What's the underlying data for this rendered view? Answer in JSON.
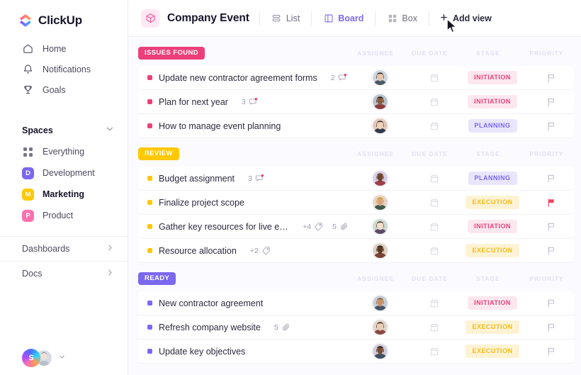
{
  "brand": {
    "name": "ClickUp",
    "logo_icon": "clickup-logo-icon"
  },
  "sidebar": {
    "nav": [
      {
        "label": "Home",
        "icon": "home-icon"
      },
      {
        "label": "Notifications",
        "icon": "bell-icon"
      },
      {
        "label": "Goals",
        "icon": "trophy-icon"
      }
    ],
    "spaces_header": {
      "label": "Spaces",
      "icon": "chevron-down-icon"
    },
    "spaces": [
      {
        "label": "Everything",
        "initial": "",
        "color": "#76758a",
        "type": "dots",
        "active": false
      },
      {
        "label": "Development",
        "initial": "D",
        "color": "#7b68ee",
        "type": "square",
        "active": false
      },
      {
        "label": "Marketing",
        "initial": "M",
        "color": "#ffc800",
        "type": "square",
        "active": true
      },
      {
        "label": "Product",
        "initial": "P",
        "color": "#fd71af",
        "type": "square",
        "active": false
      }
    ],
    "sections": [
      {
        "label": "Dashboards",
        "icon": "chevron-right-icon"
      },
      {
        "label": "Docs",
        "icon": "chevron-right-icon"
      }
    ],
    "user": {
      "initial": "S",
      "chevron_icon": "chevron-down-icon",
      "avatar_icon": "user-avatar"
    }
  },
  "header": {
    "project_icon": "box-3d-icon",
    "title": "Company Event",
    "views": [
      {
        "label": "List",
        "icon": "list-icon",
        "active": false
      },
      {
        "label": "Board",
        "icon": "board-icon",
        "active": true
      },
      {
        "label": "Box",
        "icon": "box-grid-icon",
        "active": false
      }
    ],
    "add_view": {
      "label": "Add view",
      "icon": "plus-icon"
    }
  },
  "board": {
    "column_headers": [
      "ASSIGNEE",
      "DUE DATE",
      "STAGE",
      "PRIORITY"
    ],
    "stage_colors": {
      "INITIATION": {
        "fg": "#ec3f79",
        "bg": "#fde7ef"
      },
      "PLANNING": {
        "fg": "#7b68ee",
        "bg": "#e8e5fd"
      },
      "EXECUTION": {
        "fg": "#f5bb16",
        "bg": "#fdf3d4"
      }
    },
    "groups": [
      {
        "label": "ISSUES FOUND",
        "badge_color": "#ec3f79",
        "bullet_color": "#ec3f79",
        "tasks": [
          {
            "title": "Update new contractor agreement forms",
            "comments": "2",
            "comments_icon": "comment-icon",
            "comment_unread": true,
            "tags": "",
            "attachments": "",
            "due_icon": "calendar-icon",
            "stage": "INITIATION",
            "priority_icon": "flag-icon",
            "priority_flagged": false,
            "avatar": "avatar-1"
          },
          {
            "title": "Plan for next year",
            "comments": "3",
            "comments_icon": "comment-icon",
            "comment_unread": true,
            "tags": "",
            "attachments": "",
            "due_icon": "calendar-icon",
            "stage": "INITIATION",
            "priority_icon": "flag-icon",
            "priority_flagged": false,
            "avatar": "avatar-2"
          },
          {
            "title": "How to manage event planning",
            "comments": "",
            "comments_icon": "",
            "comment_unread": false,
            "tags": "",
            "attachments": "",
            "due_icon": "calendar-icon",
            "stage": "PLANNING",
            "priority_icon": "flag-icon",
            "priority_flagged": false,
            "avatar": "avatar-3"
          }
        ]
      },
      {
        "label": "REVIEW",
        "badge_color": "#ffc800",
        "bullet_color": "#ffc800",
        "tasks": [
          {
            "title": "Budget assignment",
            "comments": "3",
            "comments_icon": "comment-icon",
            "comment_unread": true,
            "tags": "",
            "attachments": "",
            "due_icon": "calendar-icon",
            "stage": "PLANNING",
            "priority_icon": "flag-icon",
            "priority_flagged": false,
            "avatar": "avatar-4"
          },
          {
            "title": "Finalize project scope",
            "comments": "",
            "comments_icon": "",
            "comment_unread": false,
            "tags": "",
            "attachments": "",
            "due_icon": "calendar-icon",
            "stage": "EXECUTION",
            "priority_icon": "flag-icon",
            "priority_flagged": true,
            "avatar": "avatar-5"
          },
          {
            "title": "Gather key resources for live events",
            "comments": "",
            "comments_icon": "",
            "comment_unread": false,
            "tags": "+4",
            "tags_icon": "tag-icon",
            "attachments": "5",
            "attachments_icon": "paperclip-icon",
            "due_icon": "calendar-icon",
            "stage": "INITIATION",
            "priority_icon": "flag-icon",
            "priority_flagged": false,
            "avatar": "avatar-6"
          },
          {
            "title": "Resource allocation",
            "comments": "",
            "comments_icon": "",
            "comment_unread": false,
            "tags": "+2",
            "tags_icon": "tag-icon",
            "attachments": "",
            "due_icon": "calendar-icon",
            "stage": "EXECUTION",
            "priority_icon": "flag-icon",
            "priority_flagged": false,
            "avatar": "avatar-7"
          }
        ]
      },
      {
        "label": "READY",
        "badge_color": "#7b68ee",
        "bullet_color": "#7b68ee",
        "tasks": [
          {
            "title": "New contractor agreement",
            "comments": "",
            "comments_icon": "",
            "comment_unread": false,
            "tags": "",
            "attachments": "",
            "due_icon": "calendar-icon",
            "stage": "INITIATION",
            "priority_icon": "flag-icon",
            "priority_flagged": false,
            "avatar": "avatar-8"
          },
          {
            "title": "Refresh company website",
            "comments": "",
            "comments_icon": "",
            "comment_unread": false,
            "tags": "",
            "attachments": "5",
            "attachments_icon": "paperclip-icon",
            "due_icon": "calendar-icon",
            "stage": "EXECUTION",
            "priority_icon": "flag-icon",
            "priority_flagged": false,
            "avatar": "avatar-9"
          },
          {
            "title": "Update key objectives",
            "comments": "",
            "comments_icon": "",
            "comment_unread": false,
            "tags": "",
            "attachments": "",
            "due_icon": "calendar-icon",
            "stage": "EXECUTION",
            "priority_icon": "flag-icon",
            "priority_flagged": false,
            "avatar": "avatar-10"
          }
        ]
      }
    ]
  },
  "cursor": {
    "icon": "mouse-pointer-icon"
  }
}
